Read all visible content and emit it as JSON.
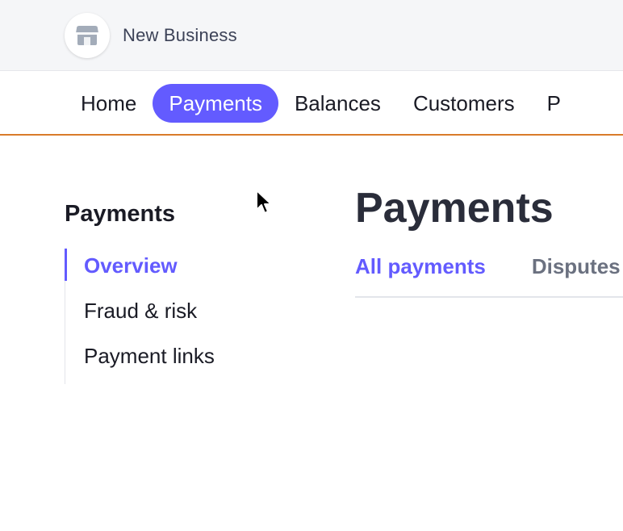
{
  "account": {
    "name": "New Business",
    "icon": "storefront-icon"
  },
  "nav": {
    "items": [
      {
        "label": "Home"
      },
      {
        "label": "Payments",
        "active": true
      },
      {
        "label": "Balances"
      },
      {
        "label": "Customers"
      },
      {
        "label": "P"
      }
    ]
  },
  "sidebar": {
    "title": "Payments",
    "links": [
      {
        "label": "Overview",
        "active": true
      },
      {
        "label": "Fraud & risk"
      },
      {
        "label": "Payment links"
      }
    ]
  },
  "main": {
    "title": "Payments",
    "tabs": [
      {
        "label": "All payments",
        "active": true
      },
      {
        "label": "Disputes"
      }
    ]
  },
  "colors": {
    "accent": "#635bff",
    "nav_border": "#d97b29"
  }
}
